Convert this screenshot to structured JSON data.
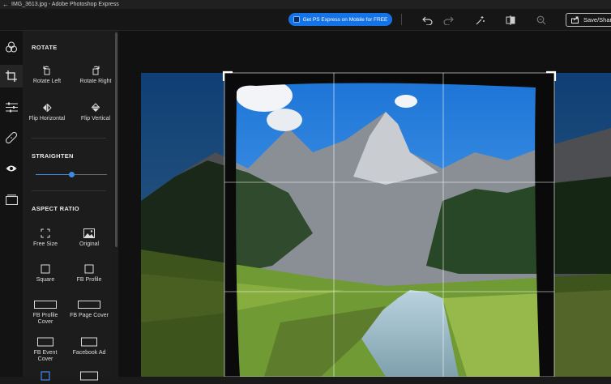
{
  "window": {
    "title": "IMG_3613.jpg - Adobe Photoshop Express"
  },
  "toolbar": {
    "promo_label": "Get PS Express on Mobile for FREE",
    "save_label": "Save/Share"
  },
  "panel": {
    "rotate": {
      "title": "ROTATE",
      "rotate_left": "Rotate Left",
      "rotate_right": "Rotate Right",
      "flip_horizontal": "Flip Horizontal",
      "flip_vertical": "Flip Vertical"
    },
    "straighten": {
      "title": "STRAIGHTEN",
      "value_fraction": 0.5
    },
    "aspect_ratio": {
      "title": "ASPECT RATIO",
      "options": [
        {
          "line1": "Free Size",
          "line2": ""
        },
        {
          "line1": "Original",
          "line2": ""
        },
        {
          "line1": "Square",
          "line2": ""
        },
        {
          "line1": "FB Profile",
          "line2": ""
        },
        {
          "line1": "FB Profile",
          "line2": "Cover"
        },
        {
          "line1": "FB Page Cover",
          "line2": ""
        },
        {
          "line1": "FB Event",
          "line2": "Cover"
        },
        {
          "line1": "Facebook Ad",
          "line2": ""
        }
      ]
    }
  },
  "colors": {
    "accent": "#1473e6",
    "slider": "#3d8be8"
  }
}
